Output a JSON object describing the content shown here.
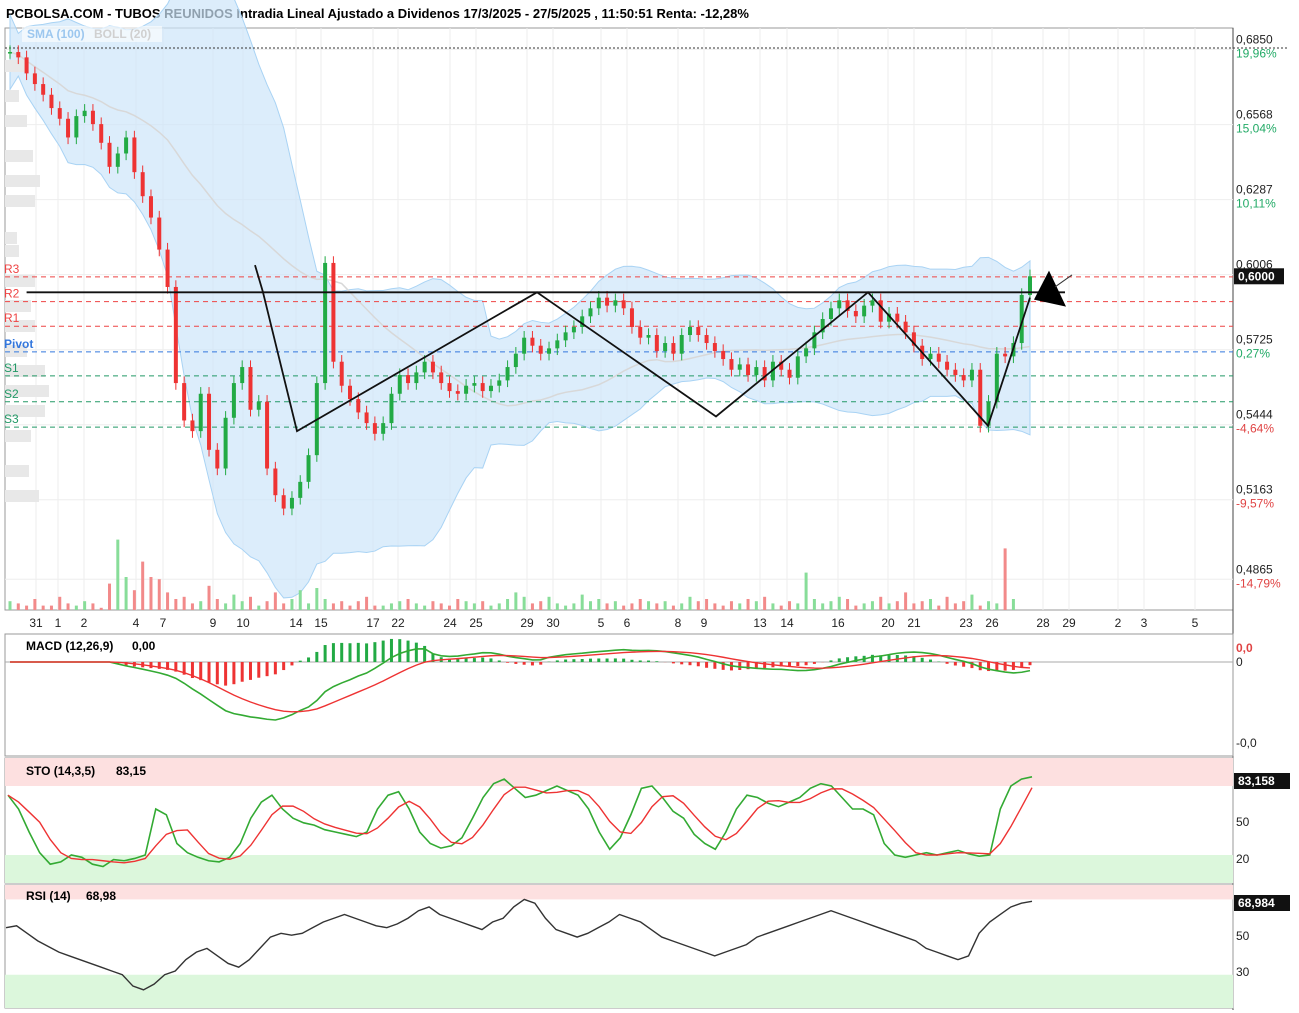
{
  "header": {
    "title": "PCBOLSA.COM - TUBOS REUNIDOS Intradia Lineal Ajustado a Dividenos 17/3/2025 - 27/5/2025 , 11:50:51 Renta: -12,28%"
  },
  "legend": {
    "sma": "SMA (100)",
    "boll": "BOLL (20)"
  },
  "colors": {
    "up": "#22aa44",
    "down": "#ee3333",
    "boll_fill": "#cde6fa",
    "pivot": "#3377dd",
    "resist": "#ee4444",
    "support": "#229966"
  },
  "chart_data": [
    {
      "type": "line",
      "name": "price",
      "y_ticks": [
        {
          "price": "0,6850",
          "pct": "19,96%",
          "sign": "pos",
          "value": 0.685
        },
        {
          "price": "0,6568",
          "pct": "15,04%",
          "sign": "pos",
          "value": 0.6568
        },
        {
          "price": "0,6287",
          "pct": "10,11%",
          "sign": "pos",
          "value": 0.6287
        },
        {
          "price": "0,6006",
          "pct": "",
          "sign": "pos",
          "value": 0.6006
        },
        {
          "price": "0,5725",
          "pct": "0,27%",
          "sign": "pos",
          "value": 0.5725
        },
        {
          "price": "0,5444",
          "pct": "-4,64%",
          "sign": "neg",
          "value": 0.5444
        },
        {
          "price": "0,5163",
          "pct": "-9,57%",
          "sign": "neg",
          "value": 0.5163
        },
        {
          "price": "0,4865",
          "pct": "-14,79%",
          "sign": "neg",
          "value": 0.4865
        }
      ],
      "last_price": "0,6000",
      "last_value": 0.6,
      "x_labels": [
        "31",
        "1",
        "2",
        "4",
        "7",
        "9",
        "10",
        "14",
        "15",
        "17",
        "22",
        "24",
        "25",
        "29",
        "30",
        "5",
        "6",
        "8",
        "9",
        "13",
        "14",
        "16",
        "20",
        "21",
        "23",
        "26",
        "28",
        "29",
        "2",
        "3",
        "5"
      ],
      "levels": [
        {
          "label": "R3",
          "value": 0.5998,
          "kind": "r"
        },
        {
          "label": "R2",
          "value": 0.5905,
          "kind": "r"
        },
        {
          "label": "R1",
          "value": 0.5813,
          "kind": "r"
        },
        {
          "label": "Pivot",
          "value": 0.5717,
          "kind": "p"
        },
        {
          "label": "S1",
          "value": 0.5627,
          "kind": "s"
        },
        {
          "label": "S2",
          "value": 0.553,
          "kind": "s"
        },
        {
          "label": "S3",
          "value": 0.5435,
          "kind": "s"
        }
      ],
      "zigzag": [
        [
          0.542,
          1
        ],
        [
          0.5485,
          12
        ],
        [
          0.567,
          23
        ],
        [
          0.594,
          40
        ],
        [
          0.56,
          62
        ],
        [
          0.551,
          70
        ],
        [
          0.594,
          88
        ],
        [
          0.572,
          104
        ],
        [
          0.544,
          115
        ],
        [
          0.592,
          122
        ]
      ],
      "neckline": 0.594,
      "close_series": [
        0.684,
        0.682,
        0.676,
        0.672,
        0.668,
        0.663,
        0.659,
        0.652,
        0.66,
        0.662,
        0.657,
        0.65,
        0.641,
        0.646,
        0.652,
        0.639,
        0.63,
        0.622,
        0.61,
        0.596,
        0.56,
        0.546,
        0.542,
        0.556,
        0.535,
        0.528,
        0.547,
        0.56,
        0.566,
        0.55,
        0.553,
        0.528,
        0.518,
        0.513,
        0.517,
        0.523,
        0.533,
        0.56,
        0.605,
        0.568,
        0.559,
        0.554,
        0.549,
        0.545,
        0.541,
        0.545,
        0.556,
        0.563,
        0.56,
        0.564,
        0.568,
        0.564,
        0.56,
        0.557,
        0.556,
        0.559,
        0.56,
        0.557,
        0.559,
        0.561,
        0.566,
        0.571,
        0.577,
        0.574,
        0.571,
        0.573,
        0.576,
        0.579,
        0.581,
        0.585,
        0.588,
        0.592,
        0.589,
        0.591,
        0.588,
        0.581,
        0.577,
        0.578,
        0.572,
        0.575,
        0.571,
        0.578,
        0.581,
        0.578,
        0.575,
        0.572,
        0.569,
        0.565,
        0.567,
        0.563,
        0.566,
        0.561,
        0.568,
        0.565,
        0.562,
        0.57,
        0.573,
        0.579,
        0.584,
        0.588,
        0.591,
        0.587,
        0.585,
        0.589,
        0.591,
        0.583,
        0.586,
        0.583,
        0.579,
        0.574,
        0.569,
        0.571,
        0.568,
        0.565,
        0.563,
        0.561,
        0.565,
        0.544,
        0.553,
        0.571,
        0.57,
        0.575,
        0.593,
        0.6
      ],
      "volume": [
        4,
        3,
        2,
        5,
        2,
        2,
        6,
        3,
        2,
        4,
        3,
        1,
        12,
        32,
        15,
        9,
        22,
        15,
        14,
        8,
        5,
        6,
        3,
        4,
        11,
        5,
        3,
        7,
        4,
        6,
        2,
        4,
        8,
        3,
        5,
        9,
        3,
        10,
        5,
        3,
        4,
        2,
        4,
        6,
        2,
        2,
        3,
        4,
        5,
        3,
        2,
        4,
        3,
        2,
        5,
        4,
        3,
        4,
        2,
        3,
        5,
        8,
        6,
        3,
        4,
        6,
        3,
        2,
        3,
        7,
        4,
        5,
        3,
        4,
        2,
        3,
        5,
        4,
        3,
        4,
        2,
        3,
        6,
        4,
        5,
        3,
        2,
        4,
        3,
        5,
        4,
        6,
        3,
        2,
        4,
        3,
        17,
        5,
        3,
        4,
        6,
        5,
        2,
        3,
        4,
        6,
        3,
        4,
        8,
        3,
        4,
        5,
        2,
        6,
        3,
        4,
        7,
        2,
        4,
        3,
        28,
        5
      ]
    },
    {
      "type": "line",
      "name": "MACD",
      "label": "MACD (12,26,9)",
      "value": "0,00",
      "y_ticks": [
        "0,0",
        "0",
        "-0,0"
      ]
    },
    {
      "type": "line",
      "name": "STO",
      "label": "STO (14,3,5)",
      "value": "83,15",
      "last_box": "83,158",
      "y_ticks": [
        "50",
        "20"
      ],
      "k_series": [
        72,
        60,
        40,
        22,
        12,
        14,
        20,
        18,
        12,
        10,
        16,
        15,
        17,
        20,
        60,
        55,
        30,
        22,
        18,
        15,
        14,
        18,
        30,
        52,
        66,
        72,
        60,
        52,
        48,
        46,
        42,
        40,
        38,
        36,
        40,
        60,
        72,
        75,
        60,
        40,
        30,
        26,
        28,
        35,
        52,
        70,
        82,
        86,
        78,
        70,
        72,
        76,
        80,
        76,
        72,
        60,
        40,
        25,
        35,
        55,
        78,
        80,
        70,
        58,
        52,
        38,
        30,
        25,
        40,
        60,
        72,
        70,
        65,
        62,
        66,
        70,
        78,
        82,
        80,
        70,
        60,
        60,
        55,
        30,
        20,
        18,
        20,
        22,
        20,
        22,
        24,
        21,
        19,
        20,
        60,
        80,
        86,
        88
      ]
    },
    {
      "type": "line",
      "name": "RSI",
      "label": "RSI (14)",
      "value": "68,98",
      "last_box": "68,984",
      "y_ticks": [
        "50",
        "30"
      ],
      "series": [
        55,
        56,
        52,
        48,
        45,
        42,
        40,
        38,
        36,
        34,
        32,
        30,
        24,
        22,
        25,
        30,
        32,
        38,
        42,
        44,
        40,
        36,
        34,
        38,
        44,
        50,
        52,
        51,
        52,
        55,
        58,
        60,
        62,
        60,
        58,
        56,
        55,
        57,
        60,
        64,
        66,
        62,
        60,
        58,
        56,
        54,
        58,
        60,
        66,
        70,
        68,
        60,
        54,
        52,
        50,
        52,
        55,
        58,
        62,
        60,
        58,
        54,
        50,
        48,
        46,
        44,
        42,
        40,
        42,
        44,
        46,
        50,
        52,
        54,
        56,
        58,
        60,
        62,
        64,
        62,
        60,
        58,
        56,
        54,
        52,
        50,
        48,
        44,
        42,
        40,
        38,
        40,
        52,
        58,
        62,
        66,
        68,
        69
      ]
    }
  ]
}
